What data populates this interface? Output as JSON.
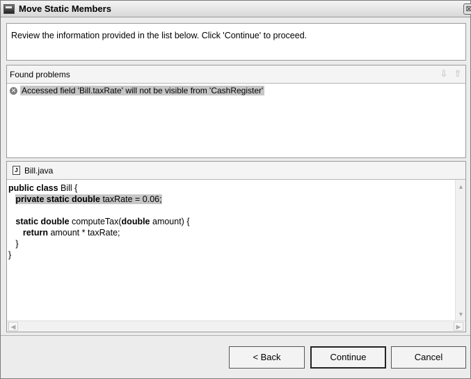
{
  "window": {
    "title": "Move Static Members",
    "close_glyph": "⊠"
  },
  "description": "Review the information provided in the list below. Click 'Continue' to proceed.",
  "problems": {
    "header": "Found problems",
    "items": [
      {
        "icon": "error-icon",
        "text": "Accessed field 'Bill.taxRate' will not be visible from 'CashRegister'"
      }
    ]
  },
  "source": {
    "filename": "Bill.java",
    "file_icon_glyph": "J",
    "lines": [
      [
        {
          "t": "public class",
          "kw": true
        },
        {
          "t": " Bill {"
        }
      ],
      [
        {
          "t": "   "
        },
        {
          "t": "private static double",
          "kw": true,
          "hl": true
        },
        {
          "t": " taxRate = 0.06;",
          "hl": true
        }
      ],
      [
        {
          "t": ""
        }
      ],
      [
        {
          "t": "   "
        },
        {
          "t": "static double",
          "kw": true
        },
        {
          "t": " computeTax("
        },
        {
          "t": "double",
          "kw": true
        },
        {
          "t": " amount) {"
        }
      ],
      [
        {
          "t": "      "
        },
        {
          "t": "return",
          "kw": true
        },
        {
          "t": " amount * taxRate;"
        }
      ],
      [
        {
          "t": "   }"
        }
      ],
      [
        {
          "t": "}"
        }
      ]
    ]
  },
  "buttons": {
    "back": "< Back",
    "continue": "Continue",
    "cancel": "Cancel"
  }
}
